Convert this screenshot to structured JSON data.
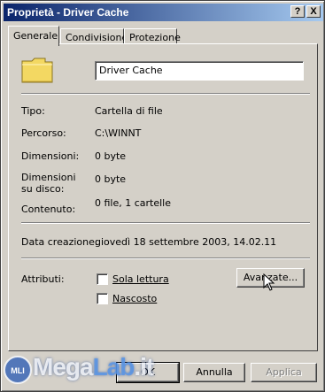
{
  "window": {
    "title": "Proprietà - Driver Cache",
    "help_button": "?",
    "close_button": "X"
  },
  "tabs": [
    {
      "label": "Generale",
      "active": true
    },
    {
      "label": "Condivisione",
      "active": false
    },
    {
      "label": "Protezione",
      "active": false
    }
  ],
  "general": {
    "folder_icon": "folder-icon",
    "name_value": "Driver Cache",
    "fields": {
      "type": {
        "label": "Tipo:",
        "value": "Cartella di file"
      },
      "path": {
        "label": "Percorso:",
        "value": "C:\\WINNT"
      },
      "size": {
        "label": "Dimensioni:",
        "value": "0 byte"
      },
      "size_on_disk": {
        "label_line1": "Dimensioni",
        "label_line2": "su disco:",
        "value": "0 byte"
      },
      "contents": {
        "label": "Contenuto:",
        "value": "0 file, 1 cartelle"
      },
      "created": {
        "label": "Data creazione:",
        "value": "giovedì 18 settembre 2003, 14.02.11"
      }
    },
    "attributes": {
      "label": "Attributi:",
      "readonly": {
        "label": "Sola lettura",
        "checked": false
      },
      "hidden": {
        "label": "Nascosto",
        "checked": false
      },
      "advanced_button": "Avanzate..."
    }
  },
  "buttons": {
    "ok": "OK",
    "cancel": "Annulla",
    "apply": "Applica",
    "apply_enabled": false
  },
  "watermark": {
    "text_part1": "Mega",
    "text_part2": "Lab",
    "text_part3": ".it",
    "logo_text": "MLI"
  },
  "colors": {
    "dialog_bg": "#d4d0c8",
    "titlebar_start": "#0a246a",
    "titlebar_end": "#a6caf0",
    "folder_yellow": "#f3d862"
  }
}
